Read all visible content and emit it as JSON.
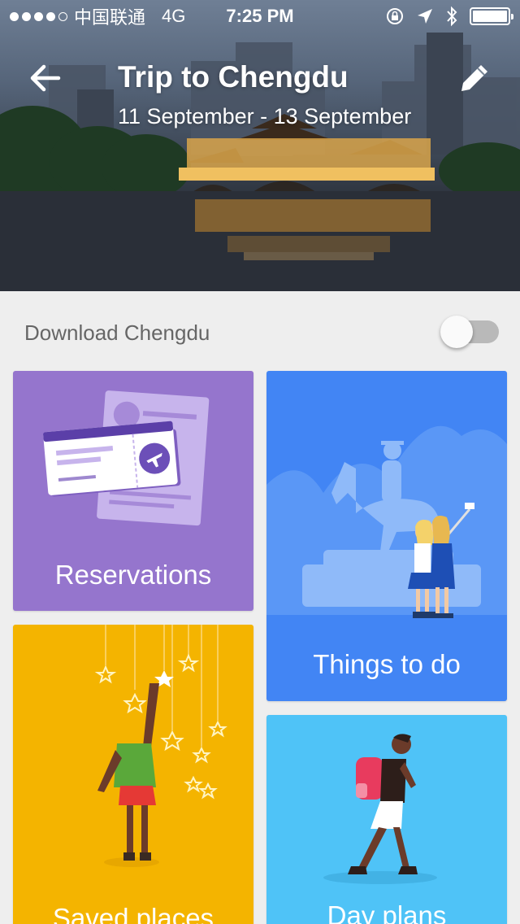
{
  "status_bar": {
    "carrier": "中国联通",
    "network": "4G",
    "time": "7:25 PM"
  },
  "header": {
    "title": "Trip to Chengdu",
    "dates": "11 September - 13 September",
    "back_icon": "arrow-back-icon",
    "edit_icon": "pencil-icon"
  },
  "download": {
    "label": "Download Chengdu",
    "enabled": false
  },
  "cards": {
    "reservations": {
      "label": "Reservations",
      "color": "#9575cd"
    },
    "things_to_do": {
      "label": "Things to do",
      "color": "#4285f4"
    },
    "saved_places": {
      "label": "Saved places",
      "color": "#f4b400"
    },
    "day_plans": {
      "label": "Day plans",
      "color": "#4fc3f7"
    }
  }
}
